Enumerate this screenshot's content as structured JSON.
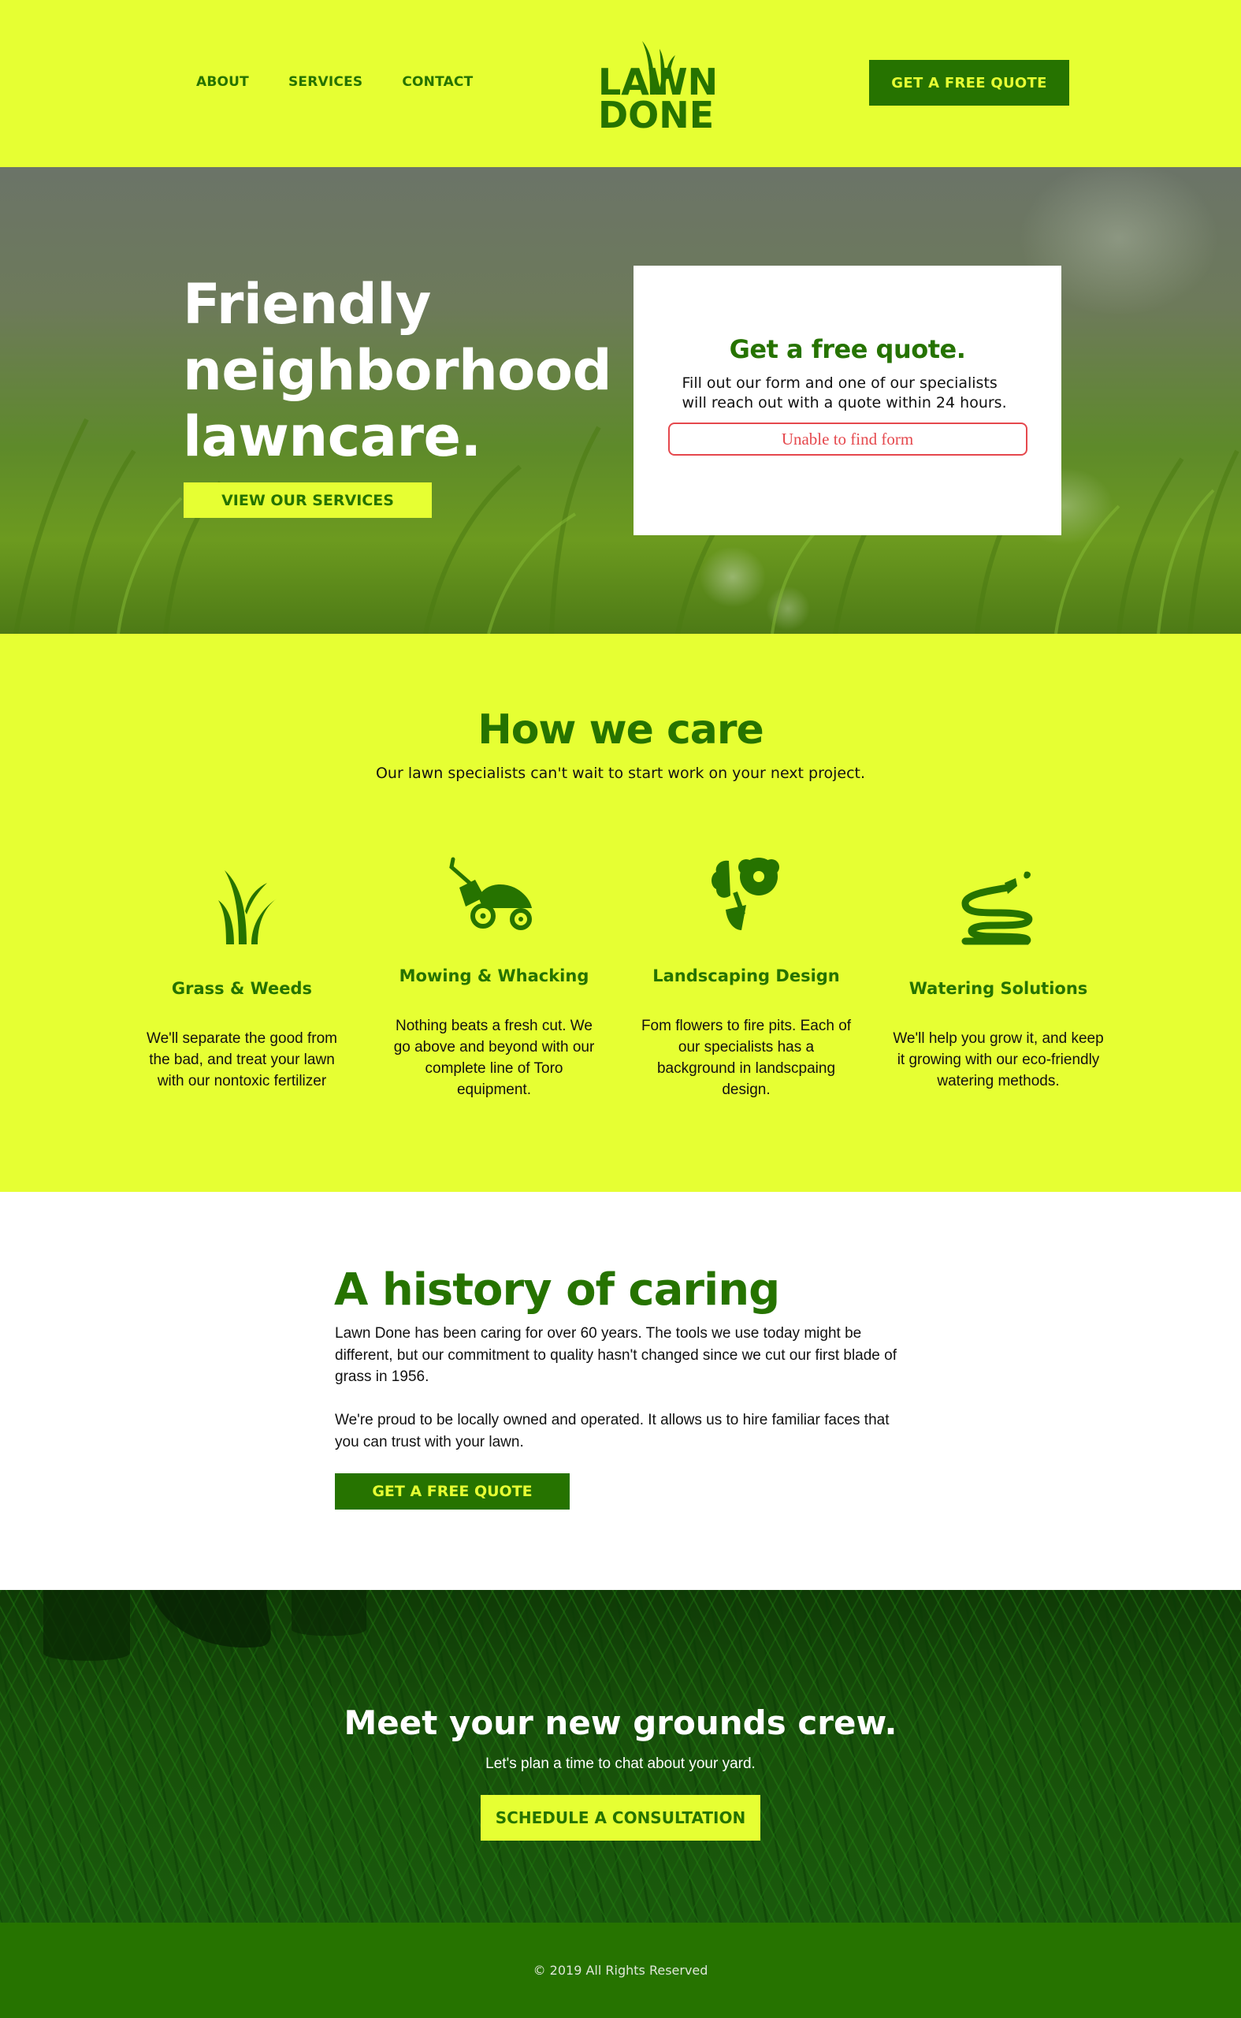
{
  "colors": {
    "lime": "#e6ff33",
    "green": "#267300",
    "error_red": "#e5484d",
    "white": "#ffffff",
    "text": "#111111"
  },
  "header": {
    "nav": [
      "ABOUT",
      "SERVICES",
      "CONTACT"
    ],
    "logo": {
      "line1": "LAWN",
      "line2": "DONE",
      "icon": "grass-blades-logo"
    },
    "cta_label": "GET A FREE QUOTE"
  },
  "hero": {
    "title": [
      "Friendly",
      "neighborhood",
      "lawncare."
    ],
    "button_label": "VIEW OUR SERVICES",
    "quote_card": {
      "title": "Get a free quote.",
      "description": "Fill out our form and one of our specialists will reach out with a quote within 24 hours.",
      "form_error": "Unable to find form"
    }
  },
  "services": {
    "title": "How we care",
    "subtitle": "Our lawn specialists can't wait to start work on your next project.",
    "items": [
      {
        "icon": "grass-icon",
        "title": "Grass & Weeds",
        "text": "We'll separate the good from the bad, and treat your lawn with our nontoxic fertilizer"
      },
      {
        "icon": "lawn-mower-icon",
        "title": "Mowing & Whacking",
        "text": "Nothing beats a fresh cut. We go above and beyond with our complete line of Toro equipment."
      },
      {
        "icon": "flower-shovel-icon",
        "title": "Landscaping Design",
        "text": "Fom flowers to fire pits. Each of our specialists has a background in landscpaing design."
      },
      {
        "icon": "garden-hose-icon",
        "title": "Watering Solutions",
        "text": "We'll help you grow it, and keep it growing with our eco-friendly watering methods."
      }
    ]
  },
  "history": {
    "title": "A history of caring",
    "paragraph1": "Lawn Done has been caring for over 60 years. The tools we use today might be different, but our commitment to quality hasn't changed since we cut our first blade of grass in 1956.",
    "paragraph2": "We're proud to be locally owned and operated. It allows us to hire familiar faces that you can trust with your lawn.",
    "button_label": "GET A FREE QUOTE"
  },
  "cta": {
    "title": "Meet your new grounds crew.",
    "subtitle": "Let's plan a time to chat about your yard.",
    "button_label": "SCHEDULE A CONSULTATION"
  },
  "footer": {
    "copyright": "© 2019 All Rights Reserved"
  }
}
